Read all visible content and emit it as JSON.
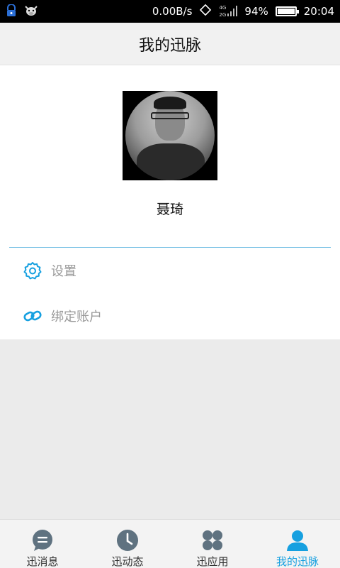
{
  "status_bar": {
    "net_speed": "0.00B/s",
    "network_top": "4G",
    "network_bottom": "2G",
    "battery": "94%",
    "battery_level": 0.94,
    "time": "20:04"
  },
  "header": {
    "title": "我的迅脉"
  },
  "profile": {
    "name": "聂琦"
  },
  "menu": {
    "items": [
      {
        "label": "设置",
        "icon": "gear-icon"
      },
      {
        "label": "绑定账户",
        "icon": "link-icon"
      }
    ]
  },
  "tabs": [
    {
      "label": "迅消息",
      "icon": "chat-icon"
    },
    {
      "label": "迅动态",
      "icon": "clock-icon"
    },
    {
      "label": "迅应用",
      "icon": "apps-icon"
    },
    {
      "label": "我的迅脉",
      "icon": "person-icon",
      "active": true
    }
  ],
  "colors": {
    "accent": "#16a0e0",
    "inactive_icon": "#5f7280",
    "divider": "#7ec4e6"
  }
}
